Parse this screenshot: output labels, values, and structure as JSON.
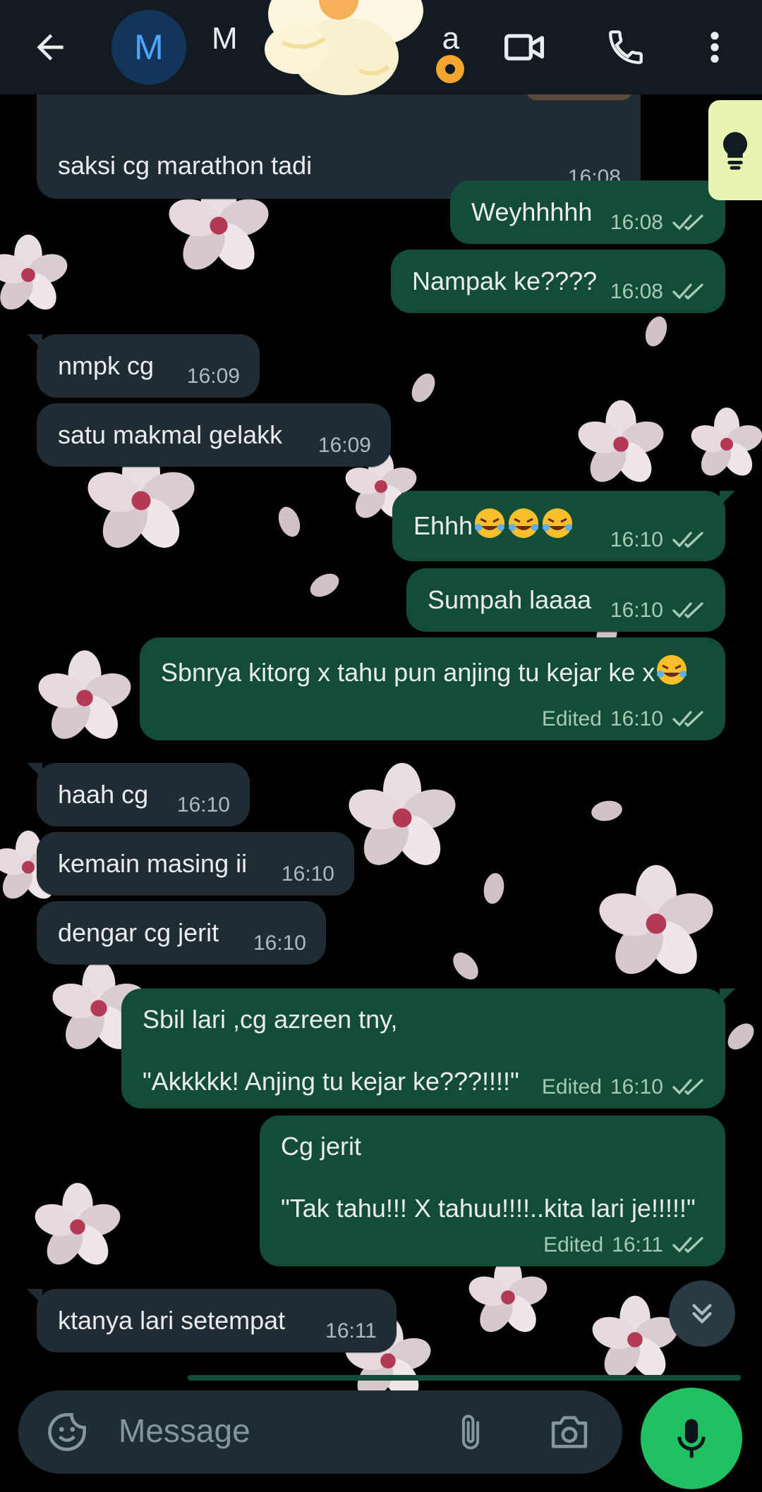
{
  "header": {
    "avatar_initial": "M",
    "contact_name": "M",
    "name_suffix": "a"
  },
  "composer": {
    "placeholder": "Message"
  },
  "colors": {
    "incoming": "#202c33",
    "outgoing": "#144d37",
    "accent": "#21c063"
  },
  "messages": [
    {
      "dir": "in",
      "text": "saksi cg marathon tadi",
      "time": "16:08",
      "edited": false
    },
    {
      "dir": "out",
      "text": "Weyhhhhh",
      "time": "16:08",
      "edited": false
    },
    {
      "dir": "out",
      "text": "Nampak ke????",
      "time": "16:08",
      "edited": false
    },
    {
      "dir": "in",
      "text": "nmpk cg",
      "time": "16:09",
      "edited": false
    },
    {
      "dir": "in",
      "text": "satu makmal gelakk",
      "time": "16:09",
      "edited": false
    },
    {
      "dir": "out",
      "text": "Ehhh",
      "time": "16:10",
      "edited": false
    },
    {
      "dir": "out",
      "text": "Sumpah laaaa",
      "time": "16:10",
      "edited": false
    },
    {
      "dir": "out",
      "text": "Sbnrya kitorg x tahu pun anjing tu kejar ke x",
      "time": "16:10",
      "edited": true
    },
    {
      "dir": "in",
      "text": "haah cg",
      "time": "16:10",
      "edited": false
    },
    {
      "dir": "in",
      "text": "kemain masing ii",
      "time": "16:10",
      "edited": false
    },
    {
      "dir": "in",
      "text": "dengar cg jerit",
      "time": "16:10",
      "edited": false
    },
    {
      "dir": "out",
      "text": "Sbil lari ,cg azreen tny,\n\n\"Akkkkk! Anjing tu kejar ke???!!!!\"",
      "time": "16:10",
      "edited": true
    },
    {
      "dir": "out",
      "text": "Cg jerit\n\n\"Tak tahu!!! X tahuu!!!!..kita lari je!!!!!\"",
      "time": "16:11",
      "edited": true
    },
    {
      "dir": "in",
      "text": "ktanya lari setempat",
      "time": "16:11",
      "edited": false
    }
  ],
  "edited_label": "Edited",
  "icons": {
    "back": "arrow-left-icon",
    "video": "video-call-icon",
    "call": "phone-icon",
    "menu": "more-vertical-icon",
    "bulb": "lightbulb-icon",
    "scroll": "chevrons-down-icon",
    "sticker": "sticker-icon",
    "attach": "paperclip-icon",
    "camera": "camera-icon",
    "mic": "microphone-icon"
  }
}
